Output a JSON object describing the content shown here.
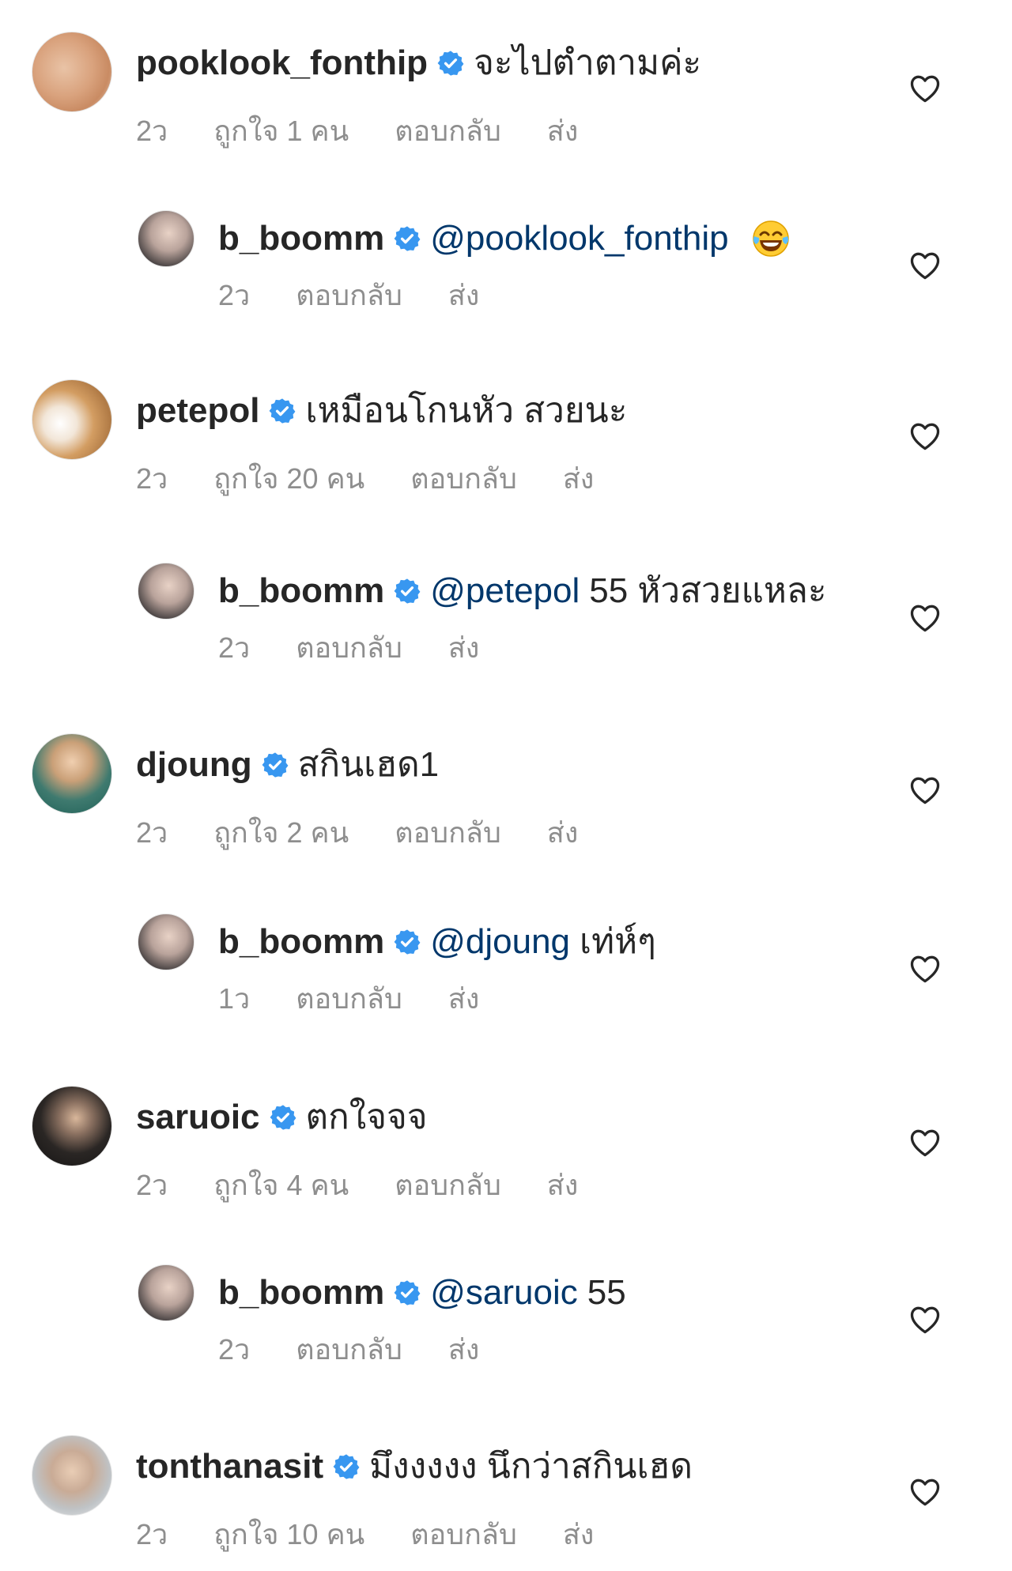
{
  "comments": [
    {
      "username": "pooklook_fonthip",
      "text": "จะไปตำตามค่ะ",
      "time": "2ว",
      "likes": "ถูกใจ 1 คน",
      "reply": "ตอบกลับ",
      "send": "ส่ง"
    },
    {
      "username": "b_boomm",
      "mention": "@pooklook_fonthip",
      "text": "",
      "emoji": "laughing-crying-emoji",
      "time": "2ว",
      "reply": "ตอบกลับ",
      "send": "ส่ง"
    },
    {
      "username": "petepol",
      "text": "เหมือนโกนหัว สวยนะ",
      "time": "2ว",
      "likes": "ถูกใจ 20 คน",
      "reply": "ตอบกลับ",
      "send": "ส่ง"
    },
    {
      "username": "b_boomm",
      "mention": "@petepol",
      "text": "55 หัวสวยแหละ",
      "time": "2ว",
      "reply": "ตอบกลับ",
      "send": "ส่ง"
    },
    {
      "username": "djoung",
      "text": "สกินเฮด1",
      "time": "2ว",
      "likes": "ถูกใจ 2 คน",
      "reply": "ตอบกลับ",
      "send": "ส่ง"
    },
    {
      "username": "b_boomm",
      "mention": "@djoung",
      "text": "เท่ห์ๆ",
      "time": "1ว",
      "reply": "ตอบกลับ",
      "send": "ส่ง"
    },
    {
      "username": "saruoic",
      "text": "ตกใจจจ",
      "time": "2ว",
      "likes": "ถูกใจ 4 คน",
      "reply": "ตอบกลับ",
      "send": "ส่ง"
    },
    {
      "username": "b_boomm",
      "mention": "@saruoic",
      "text": "55",
      "time": "2ว",
      "reply": "ตอบกลับ",
      "send": "ส่ง"
    },
    {
      "username": "tonthanasit",
      "text": "มึงงงงง นึกว่าสกินเฮด",
      "time": "2ว",
      "likes": "ถูกใจ 10 คน",
      "reply": "ตอบกลับ",
      "send": "ส่ง"
    }
  ],
  "colors": {
    "text": "#262626",
    "meta": "#8e8e8e",
    "mention": "#00376b",
    "verified": "#3897f0"
  },
  "icons": {
    "verified": "verified-badge-icon",
    "like": "heart-outline-icon"
  }
}
